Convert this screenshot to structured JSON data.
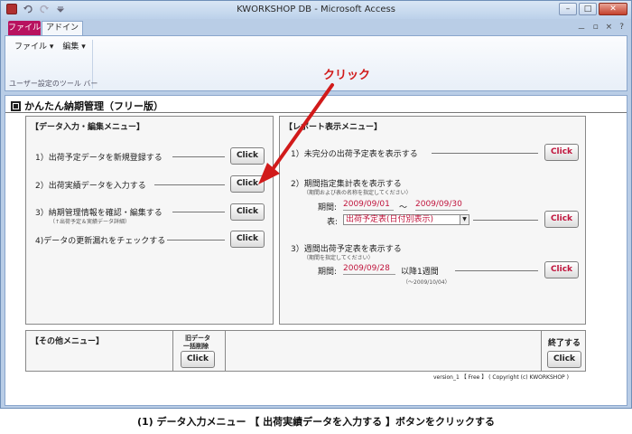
{
  "window": {
    "title": "KWORKSHOP DB - Microsoft Access",
    "minimize": "–",
    "maximize": "□",
    "close": "✕"
  },
  "ribbon": {
    "tab_file": "ファイル",
    "tab_addin": "アドイン",
    "menu_file": "ファイル ▾",
    "menu_edit": "編集 ▾",
    "group_label": "ユーザー設定のツール バー",
    "help": "?",
    "ctrl_min": "－",
    "ctrl_restore": "▫",
    "ctrl_close": "×"
  },
  "form": {
    "title": "かんたん納期管理（フリー版）",
    "data_panel": {
      "title": "【データ入力・編集メニュー】",
      "rows": [
        {
          "label": "1）出荷予定データを新規登録する",
          "button": "Click"
        },
        {
          "label": "2）出荷実績データを入力する",
          "button": "Click"
        },
        {
          "label": "3）納期管理情報を確認・編集する",
          "sub": "（↑出荷予定＆実績データ詳細）",
          "button": "Click"
        },
        {
          "label": "4)データの更新漏れをチェックする",
          "button": "Click"
        }
      ]
    },
    "report_panel": {
      "title": "【レポート表示メニュー】",
      "item1": {
        "label": "1）未完分の出荷予定表を表示する",
        "button": "Click"
      },
      "item2": {
        "label": "2）期間指定集計表を表示する",
        "sub": "（期間および表の名称を指定してください）",
        "period_label": "期間:",
        "from": "2009/09/01",
        "tilde": "〜",
        "to": "2009/09/30",
        "table_label": "表:",
        "table_value": "出荷予定表(日付別表示)",
        "button": "Click"
      },
      "item3": {
        "label": "3）週間出荷予定表を表示する",
        "sub": "（期間を指定してください）",
        "period_label": "期間:",
        "date": "2009/09/28",
        "after": "以降1週間",
        "range": "（〜2009/10/04）",
        "button": "Click"
      }
    },
    "other_panel": {
      "title": "【その他メニュー】",
      "old_data_label_1": "旧データ",
      "old_data_label_2": "一括削除",
      "old_button": "Click",
      "exit_label": "終了する",
      "exit_button": "Click"
    },
    "footer": "version_1 【 Free 】 ( Copyright (c) KWORKSHOP )"
  },
  "annotation": "クリック",
  "caption": "(1) データ入力メニュー 【 出荷実績データを入力する 】ボタンをクリックする",
  "colors": {
    "accent_red": "#d11a1a",
    "field_red": "#c0143c",
    "file_tab": "#b8125f"
  }
}
